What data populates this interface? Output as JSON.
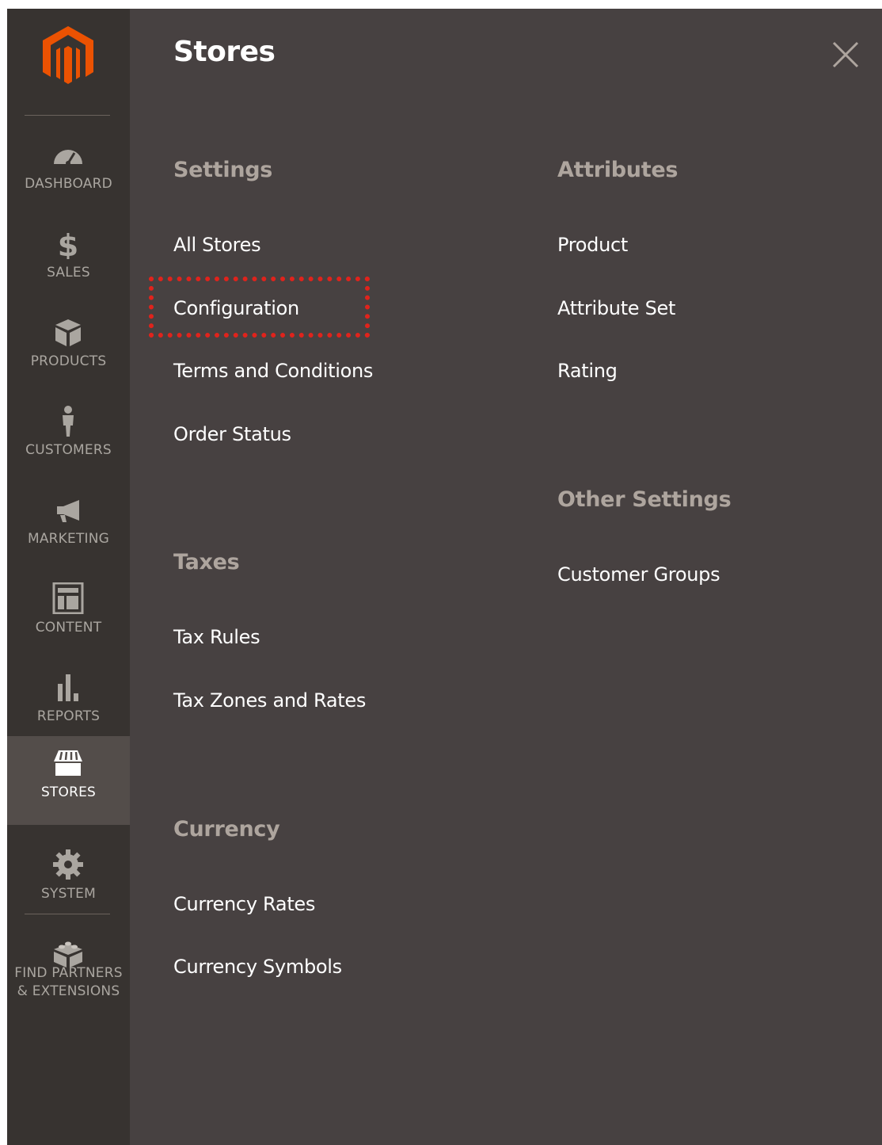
{
  "sidebar": {
    "items": [
      {
        "label": "DASHBOARD",
        "icon": "dashboard-icon"
      },
      {
        "label": "SALES",
        "icon": "dollar-icon"
      },
      {
        "label": "PRODUCTS",
        "icon": "cube-icon"
      },
      {
        "label": "CUSTOMERS",
        "icon": "person-icon"
      },
      {
        "label": "MARKETING",
        "icon": "megaphone-icon"
      },
      {
        "label": "CONTENT",
        "icon": "layout-icon"
      },
      {
        "label": "REPORTS",
        "icon": "bar-chart-icon"
      },
      {
        "label": "STORES",
        "icon": "storefront-icon",
        "active": true
      },
      {
        "label": "SYSTEM",
        "icon": "gear-icon"
      },
      {
        "label_line1": "FIND PARTNERS",
        "label_line2": "& EXTENSIONS",
        "icon": "lego-block-icon"
      }
    ]
  },
  "panel": {
    "title": "Stores",
    "groups": {
      "settings": {
        "title": "Settings",
        "links": [
          "All Stores",
          "Configuration",
          "Terms and Conditions",
          "Order Status"
        ]
      },
      "taxes": {
        "title": "Taxes",
        "links": [
          "Tax Rules",
          "Tax Zones and Rates"
        ]
      },
      "currency": {
        "title": "Currency",
        "links": [
          "Currency Rates",
          "Currency Symbols"
        ]
      },
      "attributes": {
        "title": "Attributes",
        "links": [
          "Product",
          "Attribute Set",
          "Rating"
        ]
      },
      "other_settings": {
        "title": "Other Settings",
        "links": [
          "Customer Groups"
        ]
      }
    }
  },
  "colors": {
    "sidebar_bg": "#373330",
    "panel_bg": "#474141",
    "active_item_bg": "#534d4a",
    "logo_orange": "#eb5202",
    "group_title": "#aea59e",
    "highlight_red": "#e0231c"
  }
}
